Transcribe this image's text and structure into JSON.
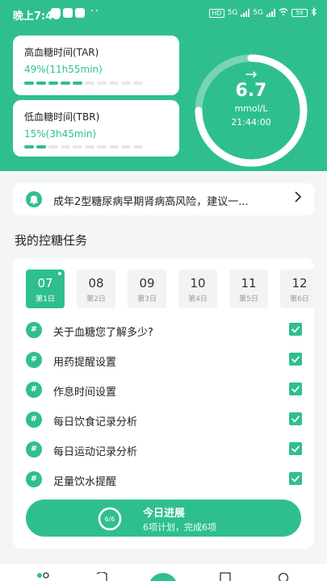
{
  "status_bar": {
    "time": "晚上7:48",
    "dots": "··",
    "network_hd": "HD",
    "network_5g_1": "5G",
    "network_5g_2": "5G",
    "battery": "59"
  },
  "tar": {
    "label": "高血糖时间(TAR)",
    "value": "49%(11h55min)",
    "level": 0.49
  },
  "tbr": {
    "label": "低血糖时间(TBR)",
    "value": "15%(3h45min)",
    "level": 0.15
  },
  "glucose": {
    "arrow": "→",
    "value": "6.7",
    "unit": "mmol/L",
    "time": "21:44:00",
    "ring_level": 0.75
  },
  "notice": {
    "text": "成年2型糖尿病早期肾病高风险，建议一..."
  },
  "tasks_section": {
    "title": "我的控糖任务"
  },
  "days": [
    {
      "num": "07",
      "label": "第1日",
      "active": true
    },
    {
      "num": "08",
      "label": "第2日",
      "active": false
    },
    {
      "num": "09",
      "label": "第3日",
      "active": false
    },
    {
      "num": "10",
      "label": "第4日",
      "active": false
    },
    {
      "num": "11",
      "label": "第5日",
      "active": false
    },
    {
      "num": "12",
      "label": "第6日",
      "active": false
    }
  ],
  "tasks": [
    {
      "hash": "#",
      "name": "关于血糖您了解多少?",
      "checked": true
    },
    {
      "hash": "#",
      "name": "用药提醒设置",
      "checked": true
    },
    {
      "hash": "#",
      "name": "作息时间设置",
      "checked": true
    },
    {
      "hash": "#",
      "name": "每日饮食记录分析",
      "checked": true
    },
    {
      "hash": "#",
      "name": "每日运动记录分析",
      "checked": true
    },
    {
      "hash": "#",
      "name": "足量饮水提醒",
      "checked": true
    }
  ],
  "progress": {
    "ring_text": "6/6",
    "title": "今日进展",
    "summary": "6项计划，完成6项",
    "level": 1.0
  },
  "colors": {
    "accent": "#2fbf8e"
  }
}
